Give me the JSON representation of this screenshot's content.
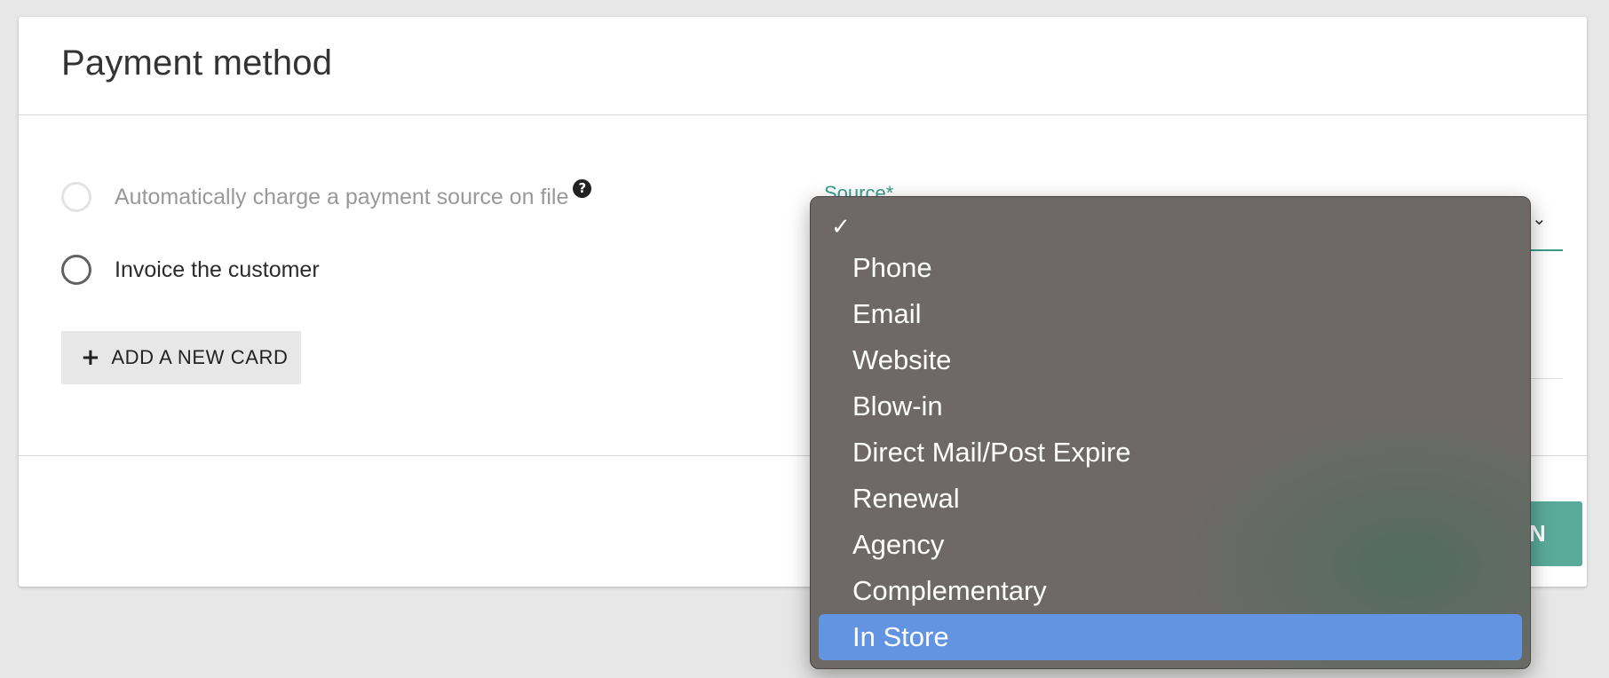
{
  "card": {
    "title": "Payment method"
  },
  "payment_options": [
    {
      "label": "Automatically charge a payment source on file",
      "disabled": true,
      "help": "?"
    },
    {
      "label": "Invoice the customer",
      "disabled": false
    }
  ],
  "add_card_button": {
    "icon": "+",
    "label": "ADD A NEW CARD"
  },
  "source_field": {
    "label": "Source*"
  },
  "submit_button": {
    "visible_text": "N"
  },
  "dropdown": {
    "checked_icon": "✓",
    "options": [
      "",
      "Phone",
      "Email",
      "Website",
      "Blow-in",
      "Direct Mail/Post Expire",
      "Renewal",
      "Agency",
      "Complementary",
      "In Store"
    ],
    "highlighted_option": "In Store",
    "checked_option": ""
  },
  "colors": {
    "accent": "#3a9c8c",
    "highlight": "#6394e2",
    "dropdown_bg": "#6e6966"
  }
}
